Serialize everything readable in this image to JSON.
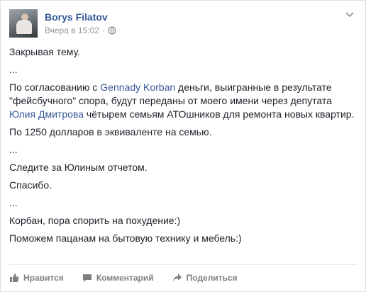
{
  "post": {
    "author": "Borys Filatov",
    "timestamp": "Вчера в 15:02",
    "separator": "·",
    "privacy_icon": "globe-icon",
    "menu_icon": "chevron-down-icon",
    "paragraphs": {
      "p1": "Закрывая тему.",
      "p2": "...",
      "p3": {
        "t1": "По согласованию с ",
        "link1": "Gennady Korban",
        "t2": " деньги, выигранные в результате \"фейсбучного\" спора, будут переданы от моего имени через депутата ",
        "link2": "Юлия Дмитрова",
        "t3": " чётырем семьям АТОшников для ремонта новых квартир."
      },
      "p4": "По 1250 долларов в эквиваленте на семью.",
      "p5": "...",
      "p6": "Следите за Юлиным отчетом.",
      "p7": "Спасибо.",
      "p8": "...",
      "p9": "Корбан, пора спорить на похудение:)",
      "p10": "Поможем пацанам на бытовую технику и мебель:)"
    }
  },
  "actions": {
    "like": "Нравится",
    "comment": "Комментарий",
    "share": "Поделиться"
  },
  "colors": {
    "link": "#365899",
    "text": "#1d2129",
    "meta": "#90949c",
    "action": "#7f7f7f"
  }
}
